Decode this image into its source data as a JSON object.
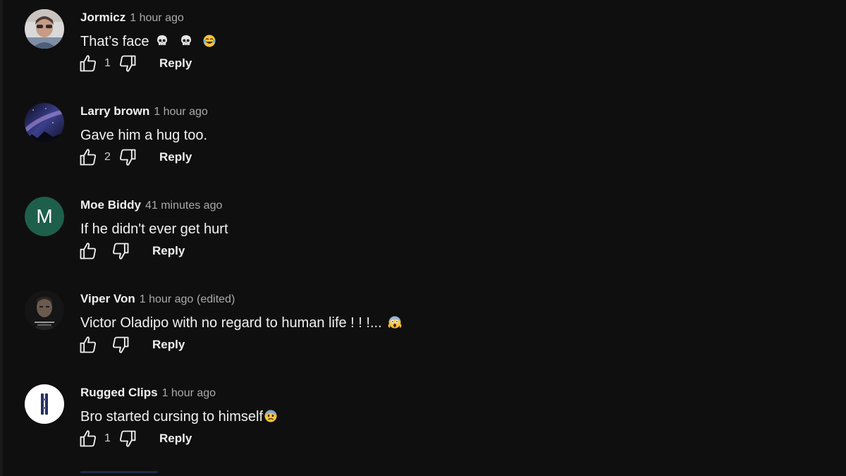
{
  "comments": [
    {
      "author": "Jormicz",
      "time": "1 hour ago",
      "edited": "",
      "text": "That’s face",
      "emojis": [
        "skull",
        "skull",
        "laughing-tears"
      ],
      "likes": "1",
      "reply_label": "Reply",
      "avatar_type": "photo-person"
    },
    {
      "author": "Larry brown",
      "time": "1 hour ago",
      "edited": "",
      "text": "Gave him a hug too.",
      "emojis": [],
      "likes": "2",
      "reply_label": "Reply",
      "avatar_type": "photo-night-sky"
    },
    {
      "author": "Moe Biddy",
      "time": "41 minutes ago",
      "edited": "",
      "text": "If he didn't ever get hurt",
      "emojis": [],
      "likes": "",
      "reply_label": "Reply",
      "avatar_type": "letter",
      "avatar_letter": "M",
      "avatar_color": "#1e5f4b"
    },
    {
      "author": "Viper Von",
      "time": "1 hour ago",
      "edited": "(edited)",
      "text": "Victor Oladipo with no regard to human life ! ! !...",
      "emojis": [
        "screaming-face"
      ],
      "likes": "",
      "reply_label": "Reply",
      "avatar_type": "photo-portrait"
    },
    {
      "author": "Rugged Clips",
      "time": "1 hour ago",
      "edited": "",
      "text": "Bro started cursing to himself",
      "emojis": [
        "anxious-face"
      ],
      "likes": "1",
      "reply_label": "Reply",
      "avatar_type": "logo-white"
    }
  ],
  "colors": {
    "background": "#0f0f0f",
    "primary_text": "#f1f1f1",
    "secondary_text": "#aaaaaa"
  }
}
